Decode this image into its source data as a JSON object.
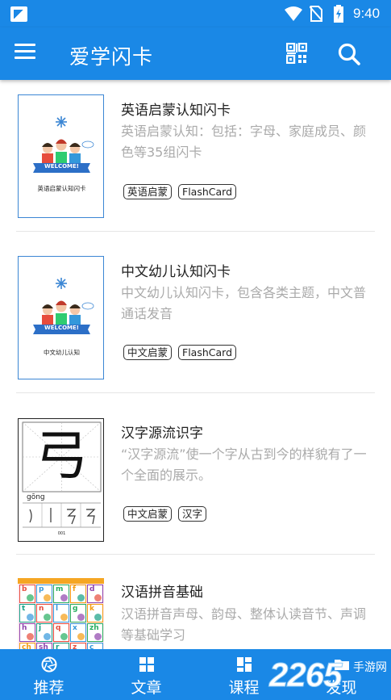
{
  "status_bar": {
    "time": "9:40"
  },
  "app_bar": {
    "title": "爱学闪卡"
  },
  "cards": [
    {
      "title": "英语启蒙认知闪卡",
      "desc": "英语启蒙认知：包括：字母、家庭成员、颜色等35组闪卡",
      "tags": [
        "英语启蒙",
        "FlashCard"
      ],
      "thumb_caption": "英语启蒙认知闪卡",
      "thumb_banner": "WELCOME!"
    },
    {
      "title": "中文幼儿认知闪卡",
      "desc": "中文幼儿认知闪卡，包含各类主题，中文普通话发音",
      "tags": [
        "中文启蒙",
        "FlashCard"
      ],
      "thumb_caption": "中文幼儿认知",
      "thumb_banner": "WELCOME!"
    },
    {
      "title": "汉字源流识字",
      "desc": "“汉字源流”使一个字从古到今的样貌有了一个全面的展示。",
      "tags": [
        "中文启蒙",
        "汉字"
      ],
      "thumb_char": "弓",
      "thumb_pinyin": "gōng",
      "thumb_number": "001"
    },
    {
      "title": "汉语拼音基础",
      "desc": "汉语拼音声母、韵母、整体认读音节、声调等基础学习",
      "tags": [],
      "thumb_letters": [
        "b",
        "p",
        "m",
        "f",
        "d",
        "t",
        "n",
        "l",
        "g",
        "k",
        "h",
        "j",
        "q",
        "x",
        "zh",
        "ch",
        "sh",
        "r",
        "z",
        "c",
        "s",
        "y",
        "w"
      ]
    }
  ],
  "tab_bar": {
    "tabs": [
      {
        "label": "推荐",
        "icon": "shutter-icon"
      },
      {
        "label": "文章",
        "icon": "grid-icon"
      },
      {
        "label": "课程",
        "icon": "dashboard-icon"
      },
      {
        "label": "发现",
        "icon": "folder-icon"
      }
    ],
    "active_index": 2
  },
  "watermark": {
    "brand": "2265",
    "site": "手游网"
  },
  "colors": {
    "primary": "#1a88e6",
    "text": "#222222",
    "muted": "#aaaaaa",
    "thumb_border": "#3b86d4"
  }
}
